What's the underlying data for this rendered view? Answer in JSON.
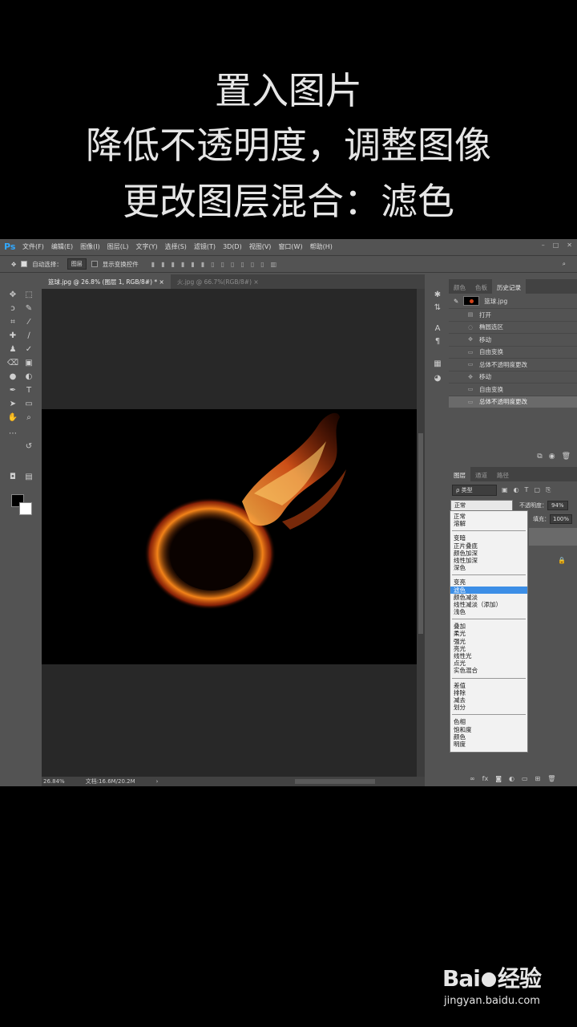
{
  "captions": [
    "置入图片",
    "降低不透明度，调整图像",
    "更改图层混合：滤色"
  ],
  "app": {
    "logo": "Ps",
    "color_accent": "#31a8ff"
  },
  "menu": [
    "文件(F)",
    "编辑(E)",
    "图像(I)",
    "图层(L)",
    "文字(Y)",
    "选择(S)",
    "滤镜(T)",
    "3D(D)",
    "视图(V)",
    "窗口(W)",
    "帮助(H)"
  ],
  "options": {
    "auto_select_label": "自动选择：",
    "auto_select_value": "图层",
    "transform_label": "显示变换控件"
  },
  "doc_tabs": [
    {
      "label": "篮球.jpg @ 26.8% (图层 1, RGB/8#) *",
      "close": "×"
    },
    {
      "label": "火.jpg @ 66.7%(RGB/8#)",
      "close": "×"
    }
  ],
  "status": {
    "zoom": "26.84%",
    "doc": "文档:16.6M/20.2M",
    "arrow": "›"
  },
  "history_panel": {
    "tabs": [
      "颜色",
      "色板",
      "历史记录"
    ],
    "active_tab": "历史记录",
    "source": "篮球.jpg",
    "items": [
      "打开",
      "椭圆选区",
      "移动",
      "自由变换",
      "总体不透明度更改",
      "移动",
      "自由变换",
      "总体不透明度更改"
    ],
    "selected_index": 7
  },
  "layers_panel": {
    "tabs": [
      "图层",
      "通道",
      "路径"
    ],
    "active_tab": "图层",
    "filter": "ρ 类型",
    "blend_mode": "正常",
    "opacity_label": "不透明度：",
    "opacity_value": "94%",
    "fill_label": "填充：",
    "fill_value": "100%"
  },
  "blend_menu": {
    "groups": [
      [
        "正常",
        "溶解"
      ],
      [
        "变暗",
        "正片叠底",
        "颜色加深",
        "线性加深",
        "深色"
      ],
      [
        "变亮",
        "滤色",
        "颜色减淡",
        "线性减淡（添加）",
        "浅色"
      ],
      [
        "叠加",
        "柔光",
        "强光",
        "亮光",
        "线性光",
        "点光",
        "实色混合"
      ],
      [
        "差值",
        "排除",
        "减去",
        "划分"
      ],
      [
        "色相",
        "饱和度",
        "颜色",
        "明度"
      ]
    ],
    "selected": "滤色"
  },
  "watermark": {
    "logo": "Bai",
    "logo_suffix": "经验",
    "url": "jingyan.baidu.com"
  }
}
